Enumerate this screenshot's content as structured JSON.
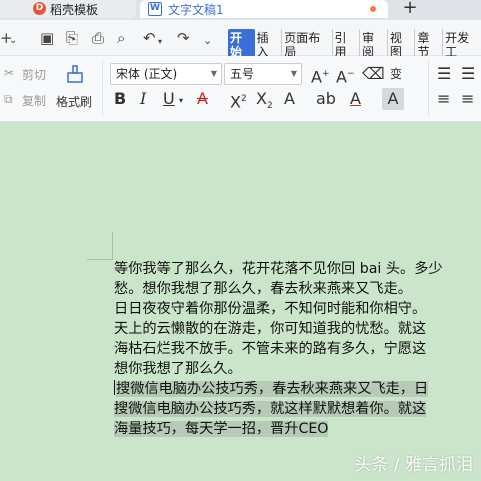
{
  "tabs": {
    "daoke": "稻壳模板",
    "doc": "文字文稿1",
    "new_tab": "+"
  },
  "menus": [
    "开始",
    "插入",
    "页面布局",
    "引用",
    "审阅",
    "视图",
    "章节",
    "开发工"
  ],
  "active_menu": "开始",
  "ribbon": {
    "cut": "剪切",
    "copy": "复制",
    "format_painter": "格式刷",
    "font_name": "宋体 (正文)",
    "font_size": "五号"
  },
  "document": {
    "lines": [
      "等你我等了那么久，花开花落不见你回 bai 头。多少",
      "愁。想你我想了那么久，春去秋来燕来又飞走。",
      "日日夜夜守着你那份温柔，不知何时能和你相守。",
      "天上的云懒散的在游走，你可知道我的忧愁。就这",
      "海枯石烂我不放手。不管未来的路有多久，宁愿这",
      "想你我想了那么久。"
    ],
    "selected_lines": [
      "搜微信电脑办公技巧秀，春去秋来燕来又飞走，日",
      "搜微信电脑办公技巧秀，就这样默默想着你。就这",
      "海量技巧，每天学一招，晋升CEO"
    ]
  },
  "watermark": "头条 / 雅言抓泪"
}
